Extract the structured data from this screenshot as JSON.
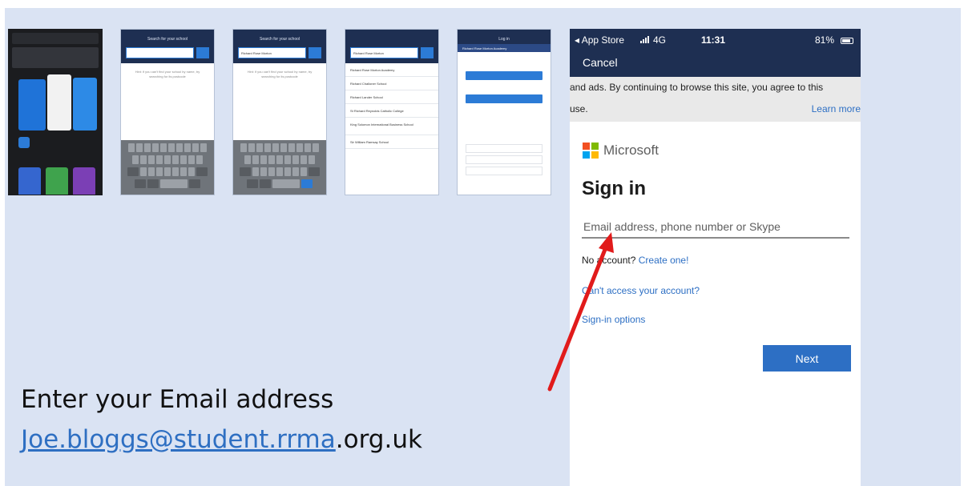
{
  "thumbnails": {
    "t2_header": "Search for your school",
    "t3_header": "Search for your school",
    "t3_query": "Richard Rose Morton",
    "t4_query": "Richard Rose Morton",
    "t4_rows": [
      "Richard Rose Morton Academy",
      "Richard Challoner School",
      "Richard Lander School",
      "St Richard Reynolds Catholic College",
      "King Solomon International Business School",
      "Sir William Ramsay School"
    ],
    "t5_header": "Log in",
    "t5_school": "Richard Rose Morton Academy"
  },
  "phone": {
    "status": {
      "carrier": "◂ App Store",
      "network": "4G",
      "time": "11:31",
      "battery": "81%"
    },
    "nav_cancel": "Cancel",
    "banner_line1": "and ads. By continuing to browse this site, you agree to this",
    "banner_line2": "use.",
    "banner_learn_more": "Learn more",
    "brand": "Microsoft",
    "title": "Sign in",
    "email_placeholder": "Email address, phone number or Skype",
    "no_account": "No account?",
    "create_one": "Create one!",
    "cant_access": "Can't access your account?",
    "signin_options": "Sign-in options",
    "next": "Next"
  },
  "caption": {
    "line1": "Enter your Email address",
    "email_linked": "Joe.bloggs@student.rrma",
    "email_rest": ".org.uk"
  },
  "colors": {
    "slide_bg": "#dae3f3",
    "nav_dark": "#1e2f52",
    "accent_blue": "#2d6fc4",
    "arrow": "#e11b1b"
  },
  "microsoft_logo_colors": [
    "#f25022",
    "#7fba00",
    "#00a4ef",
    "#ffb900"
  ]
}
